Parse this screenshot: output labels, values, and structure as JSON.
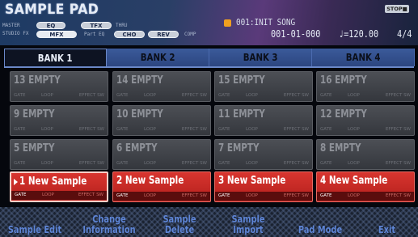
{
  "header": {
    "title": "SAMPLE PAD",
    "master_label": "MASTER",
    "studio_fx_label": "STUDIO FX",
    "eq_pill": "EQ",
    "tfx_pill": "TFX",
    "thru_label": "THRU",
    "mfx_pill": "MFX",
    "part_eq_label": "Part EQ",
    "cho_pill": "CHO",
    "rev_pill": "REV",
    "comp_label": "COMP",
    "song_icon": "song-icon",
    "song_name": "001:INIT SONG",
    "position": "001-01-000",
    "tempo": "♩=120.00",
    "beat": "4/4",
    "transport_status": "STOP■"
  },
  "tabs": [
    {
      "label": "BANK 1",
      "active": true
    },
    {
      "label": "BANK 2",
      "active": false
    },
    {
      "label": "BANK 3",
      "active": false
    },
    {
      "label": "BANK 4",
      "active": false
    }
  ],
  "pad_status_labels": {
    "gate": "GATE",
    "loop": "LOOP",
    "effect": "EFFECT SW"
  },
  "pads": [
    {
      "name": "13 EMPTY"
    },
    {
      "name": "14 EMPTY"
    },
    {
      "name": "15 EMPTY"
    },
    {
      "name": "16 EMPTY"
    },
    {
      "name": "9 EMPTY"
    },
    {
      "name": "10 EMPTY"
    },
    {
      "name": "11 EMPTY"
    },
    {
      "name": "12 EMPTY"
    },
    {
      "name": "5 EMPTY"
    },
    {
      "name": "6 EMPTY"
    },
    {
      "name": "7 EMPTY"
    },
    {
      "name": "8 EMPTY"
    },
    {
      "name": "1 New Sample"
    },
    {
      "name": "2 New Sample"
    },
    {
      "name": "3 New Sample"
    },
    {
      "name": "4 New Sample"
    }
  ],
  "footer": {
    "f1": [
      "Sample Edit"
    ],
    "f2": [
      "Change",
      "Information"
    ],
    "f3": [
      "Sample",
      "Delete"
    ],
    "f4": [
      "Sample",
      "Import"
    ],
    "f5": [
      "Pad Mode"
    ],
    "f6": [
      "Exit"
    ]
  },
  "colors": {
    "loaded_pad": "#d8352f",
    "empty_pad": "#45484e",
    "function_text": "#5f86d6",
    "tab_inactive": "#34508c"
  }
}
